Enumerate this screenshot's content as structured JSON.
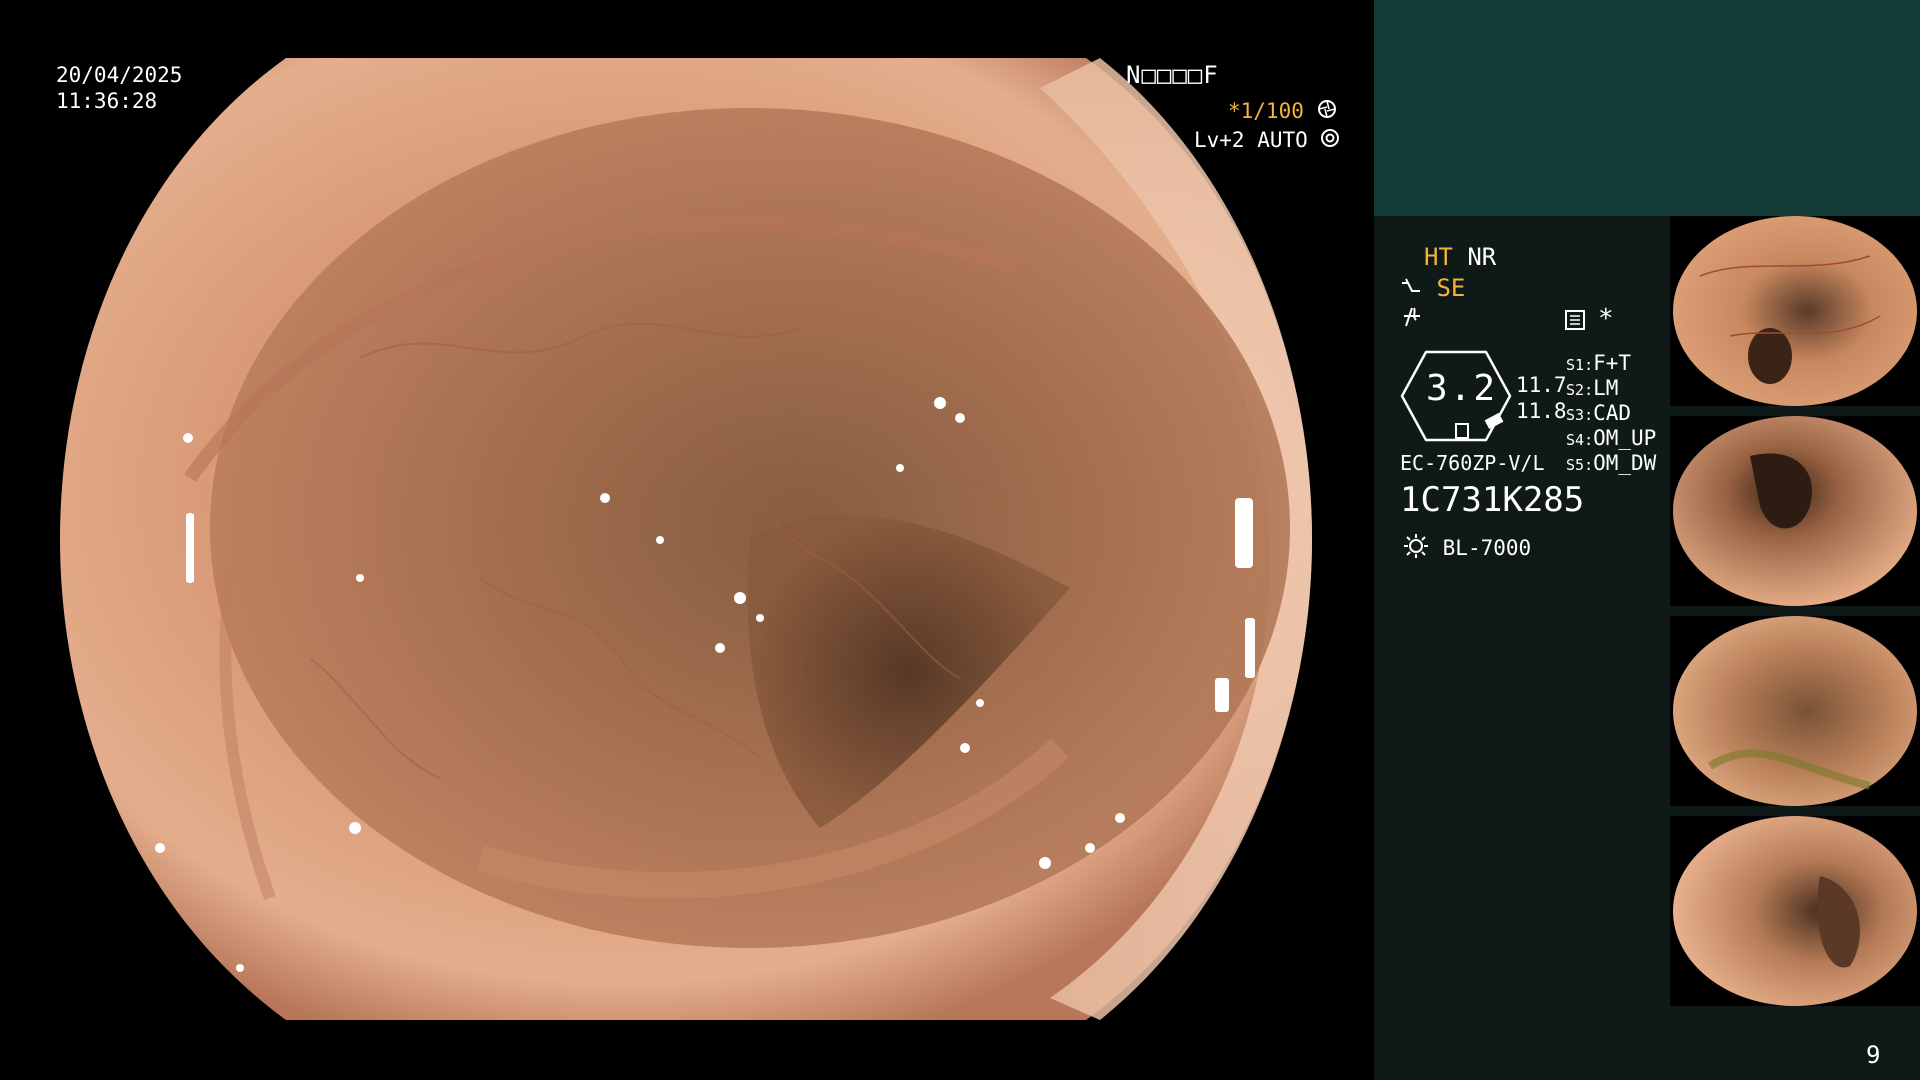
{
  "overlay": {
    "date": "20/04/2025",
    "time": "11:36:28",
    "patient_name": "N□□□□F",
    "shutter": "*1/100",
    "shutter_icon": "shutter-icon",
    "light_level": "Lv+2",
    "exposure_mode": "AUTO",
    "exposure_icon": "iris-icon"
  },
  "panel": {
    "mode_ht": "HT",
    "mode_nr": "NR",
    "enhance": "SE",
    "enhance_icon": "structure-enhance-icon",
    "color_icon": "color-enhance-icon",
    "record_icon": "record-icon",
    "record_mark": "*",
    "zoom_value": "3.2",
    "meas_1": "11.7",
    "meas_2": "11.8",
    "scope_model": "EC-760ZP-V/L",
    "scope_serial": "1C731K285",
    "light_source": "BL-7000",
    "light_icon": "light-source-icon",
    "switches": [
      {
        "key": "S1",
        "value": "F+T"
      },
      {
        "key": "S2",
        "value": "LM"
      },
      {
        "key": "S3",
        "value": "CAD"
      },
      {
        "key": "S4",
        "value": "OM_UP"
      },
      {
        "key": "S5",
        "value": "OM_DW"
      }
    ],
    "page_number": "9"
  },
  "colors": {
    "amber": "#f2b33a",
    "panel_top": "#143c37",
    "panel_bg": "#0f1918"
  }
}
